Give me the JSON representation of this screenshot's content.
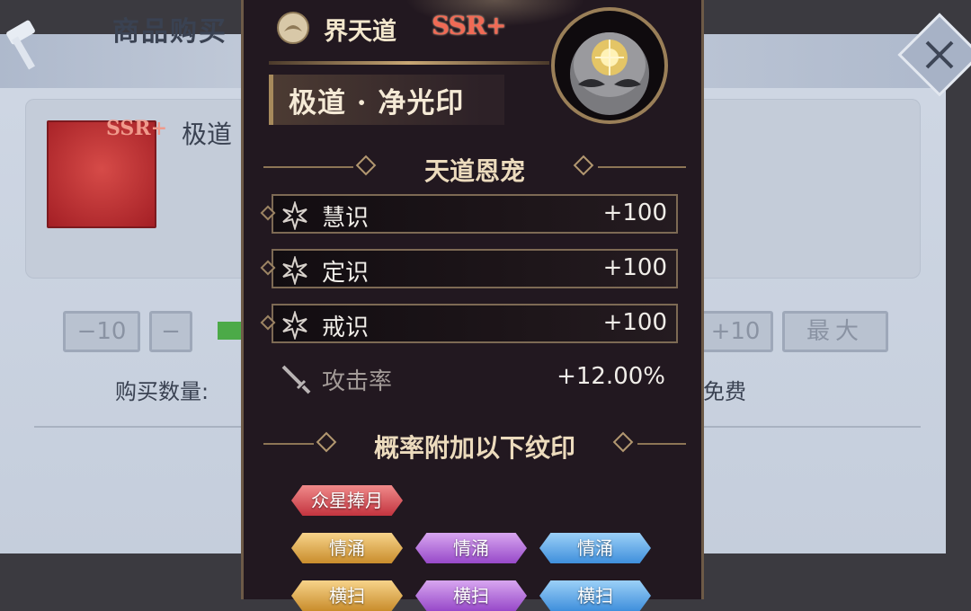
{
  "background_dialog": {
    "title": "商品购买",
    "item_name": "极道",
    "item_rarity": "SSR+",
    "minus10_label": "−10",
    "minus_label": "−",
    "plus10_label": "+10",
    "max_label": "最大",
    "quantity_label": "购买数量:",
    "price_text": "免费"
  },
  "panel": {
    "sect_name": "界天道",
    "rarity": "SSR+",
    "item_title": "极道 · 净光印",
    "section1_title": "天道恩宠",
    "stats": [
      {
        "name": "慧识",
        "value": "+100"
      },
      {
        "name": "定识",
        "value": "+100"
      },
      {
        "name": "戒识",
        "value": "+100"
      }
    ],
    "attack": {
      "name": "攻击率",
      "value": "+12.00%"
    },
    "section2_title": "概率附加以下纹印",
    "tags": [
      {
        "label": "众星捧月",
        "color": "red"
      },
      {
        "label": "情涌",
        "color": "gold"
      },
      {
        "label": "情涌",
        "color": "purple"
      },
      {
        "label": "情涌",
        "color": "blue"
      },
      {
        "label": "横扫",
        "color": "gold"
      },
      {
        "label": "横扫",
        "color": "purple"
      },
      {
        "label": "横扫",
        "color": "blue"
      }
    ]
  },
  "colors": {
    "panel_bg": "#221820",
    "gold_trim": "#9a7f58",
    "rarity_red": "#f06a55"
  }
}
